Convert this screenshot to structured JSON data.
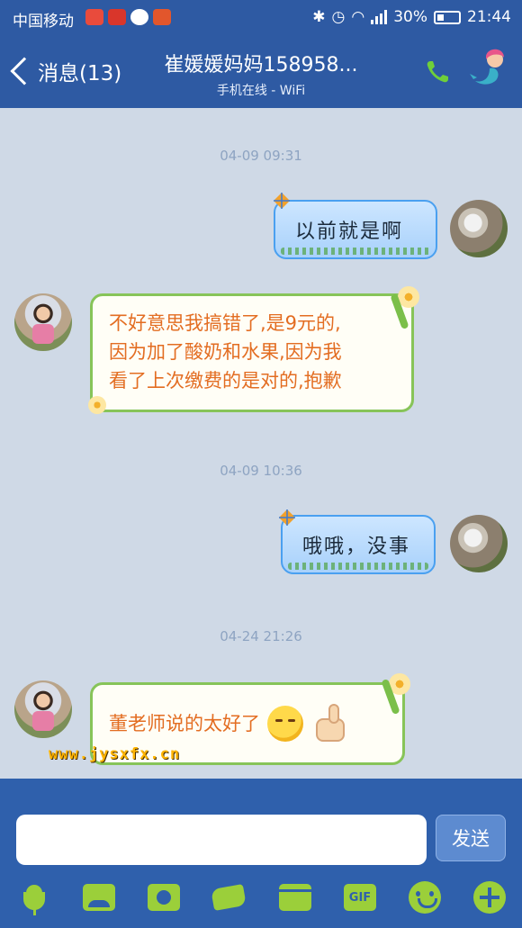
{
  "status_bar": {
    "carrier": "中国移动",
    "battery": "30%",
    "time": "21:44"
  },
  "header": {
    "back_label": "消息(13)",
    "title": "崔媛媛妈妈158958...",
    "subtitle": "手机在线 - WiFi"
  },
  "messages": [
    {
      "type": "timestamp",
      "text": "04-09 09:31"
    },
    {
      "type": "sent",
      "text": "以前就是啊"
    },
    {
      "type": "received",
      "lines": [
        "不好意思我搞错了,是9元的,",
        "因为加了酸奶和水果,因为我",
        "看了上次缴费的是对的,抱歉"
      ]
    },
    {
      "type": "timestamp",
      "text": "04-09 10:36"
    },
    {
      "type": "sent",
      "text": "哦哦，没事"
    },
    {
      "type": "timestamp",
      "text": "04-24 21:26"
    },
    {
      "type": "received",
      "text": "董老师说的太好了"
    }
  ],
  "watermark": "www.jysxfx.cn",
  "input": {
    "placeholder": "",
    "send_label": "发送"
  },
  "toolbar": {
    "gif_label": "GIF"
  },
  "colors": {
    "header_bg": "#2e5aa3",
    "chat_bg": "#cfd9e6",
    "received_text": "#e36d22",
    "toolbar_icon": "#9bcf3a"
  }
}
